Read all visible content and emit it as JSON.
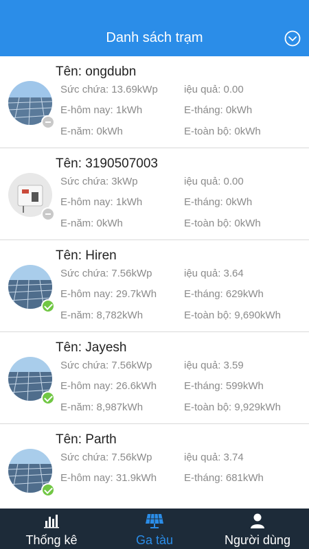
{
  "header": {
    "title": "Danh sách trạm",
    "toggle_icon": "chevron-down-circle-icon"
  },
  "colors": {
    "header_bg": "#2b8de8",
    "tabbar_bg": "#1d2b39",
    "online": "#71c744",
    "offline": "#c9c9c9"
  },
  "stations": [
    {
      "name": "Tên: ongdubn",
      "status": "offline",
      "capacity": "Sức chứa: 13.69kWp",
      "efficiency": "iệu quả: 0.00",
      "today": "E-hôm nay: 1kWh",
      "month": "E-tháng: 0kWh",
      "year": "E-năm: 0kWh",
      "total": "E-toàn bộ: 0kWh"
    },
    {
      "name": "Tên: 3190507003",
      "status": "offline",
      "capacity": "Sức chứa: 3kWp",
      "efficiency": "iệu quả: 0.00",
      "today": "E-hôm nay: 1kWh",
      "month": "E-tháng: 0kWh",
      "year": "E-năm: 0kWh",
      "total": "E-toàn bộ: 0kWh"
    },
    {
      "name": "Tên: Hiren",
      "status": "online",
      "capacity": "Sức chứa: 7.56kWp",
      "efficiency": "iệu quả: 3.64",
      "today": "E-hôm nay: 29.7kWh",
      "month": "E-tháng: 629kWh",
      "year": "E-năm: 8,782kWh",
      "total": "E-toàn bộ: 9,690kWh"
    },
    {
      "name": "Tên: Jayesh",
      "status": "online",
      "capacity": "Sức chứa: 7.56kWp",
      "efficiency": "iệu quả: 3.59",
      "today": "E-hôm nay: 26.6kWh",
      "month": "E-tháng: 599kWh",
      "year": "E-năm: 8,987kWh",
      "total": "E-toàn bộ: 9,929kWh"
    },
    {
      "name": "Tên: Parth",
      "status": "online",
      "capacity": "Sức chứa: 7.56kWp",
      "efficiency": "iệu quả: 3.74",
      "today": "E-hôm nay: 31.9kWh",
      "month": "E-tháng: 681kWh",
      "year": "",
      "total": ""
    }
  ],
  "tabs": [
    {
      "label": "Thống kê",
      "icon": "bar-chart-icon"
    },
    {
      "label": "Ga tàu",
      "icon": "solar-panel-icon"
    },
    {
      "label": "Người dùng",
      "icon": "user-icon"
    }
  ]
}
